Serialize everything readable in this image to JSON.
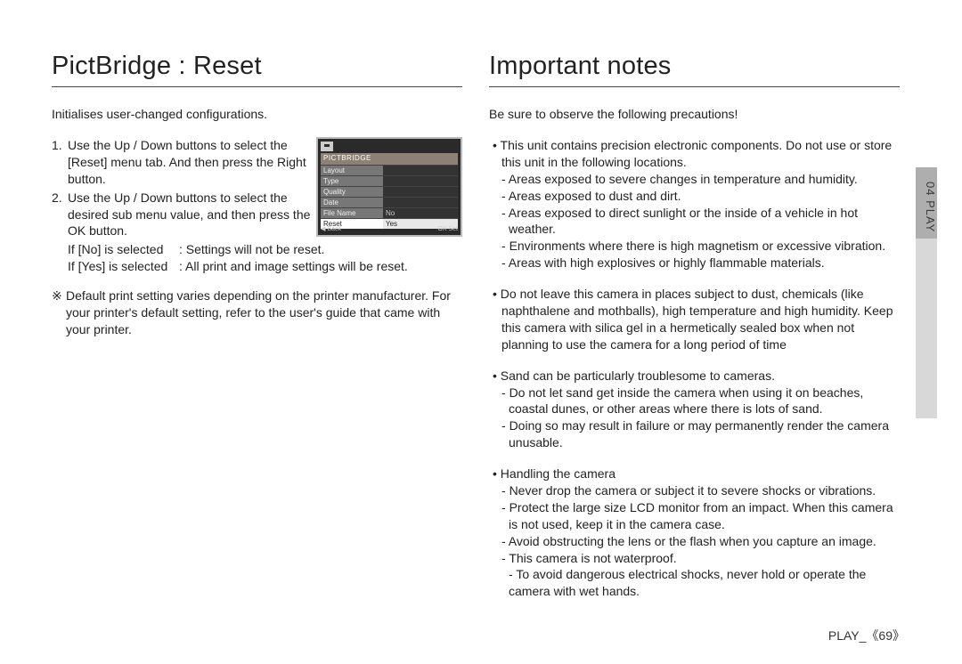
{
  "left": {
    "title": "PictBridge : Reset",
    "intro": "Initialises user-changed configurations.",
    "step1_num": "1.",
    "step1": "Use the Up / Down buttons to select the [Reset] menu tab. And then press the Right button.",
    "step2_num": "2.",
    "step2": "Use the Up / Down buttons to select the desired sub menu value, and then press the OK button.",
    "ifno_label": "If [No] is selected",
    "ifno_text": ": Settings will not be reset.",
    "ifyes_label": "If [Yes] is selected",
    "ifyes_text": ": All print and image settings will be reset.",
    "note_sym": "※",
    "note": "Default print setting varies depending on the printer manufacturer. For your printer's default setting, refer to the user's guide that came with your printer."
  },
  "lcd": {
    "header": "PICTBRIDGE",
    "rows": [
      {
        "l": "Layout",
        "r": ""
      },
      {
        "l": "Type",
        "r": ""
      },
      {
        "l": "Quality",
        "r": ""
      },
      {
        "l": "Date",
        "r": ""
      },
      {
        "l": "File Name",
        "r": "No"
      },
      {
        "l": "Reset",
        "r": "Yes"
      }
    ],
    "footer_left": "Back",
    "footer_right": "Set",
    "footer_right_pre": "OK"
  },
  "right": {
    "title": "Important notes",
    "intro": "Be sure to observe the following precautions!",
    "b1": "This unit contains precision electronic components. Do not use or store this unit in the following locations.",
    "b1d1": "Areas exposed to severe changes in temperature and humidity.",
    "b1d2": "Areas exposed to dust and dirt.",
    "b1d3": "Areas exposed to direct sunlight or the inside of a vehicle in hot weather.",
    "b1d4": "Environments where there is high magnetism or excessive vibration.",
    "b1d5": "Areas with high explosives or highly flammable materials.",
    "b2": "Do not leave this camera in places subject to dust, chemicals (like naphthalene and mothballs), high temperature and high humidity. Keep this camera with silica gel in a hermetically sealed box when not planning to use the camera for a long period of time",
    "b3": "Sand can be particularly troublesome to cameras.",
    "b3d1": "Do not let sand get inside the camera when using it on beaches, coastal dunes, or other areas where there is lots of sand.",
    "b3d2": "Doing so may result in failure or may permanently render the camera unusable.",
    "b4": "Handling the camera",
    "b4d1": "Never drop the camera or subject it to severe shocks or vibrations.",
    "b4d2": "Protect  the large size LCD monitor from an impact. When this camera is not used, keep it in the camera case.",
    "b4d3": "Avoid obstructing the lens or the flash when you capture an image.",
    "b4d4": "This camera is not waterproof.",
    "b4d4b": "To avoid dangerous electrical shocks, never hold or operate the camera with wet hands."
  },
  "tab": {
    "label": "04 PLAY"
  },
  "footer": {
    "section": "PLAY_",
    "open": "《",
    "num": "69",
    "close": "》"
  }
}
